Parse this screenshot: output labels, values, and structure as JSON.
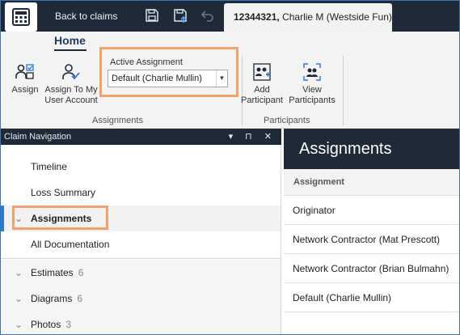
{
  "titlebar": {
    "back_label": "Back to claims",
    "icons": [
      "save-icon",
      "save-upload-icon",
      "undo-icon"
    ],
    "tab_claim_number": "12344321,",
    "tab_claim_name": " Charlie M (Westside Fun)"
  },
  "ribbon": {
    "home_tab": "Home",
    "assign_label": "Assign",
    "assign_to_me_line1": "Assign To My",
    "assign_to_me_line2": "User Account",
    "active_assignment_label": "Active Assignment",
    "active_assignment_value": "Default (Charlie Mullin)",
    "group_assignments": "Assignments",
    "add_participant_line1": "Add",
    "add_participant_line2": "Participant",
    "view_participants_line1": "View",
    "view_participants_line2": "Participants",
    "group_participants": "Participants"
  },
  "nav": {
    "title": "Claim Navigation",
    "controls": "▾ ⊓ ✕",
    "items": [
      {
        "label": "Timeline"
      },
      {
        "label": "Loss Summary"
      },
      {
        "label": "Assignments"
      },
      {
        "label": "All Documentation"
      }
    ],
    "groups": [
      {
        "label": "Estimates",
        "count": "6"
      },
      {
        "label": "Diagrams",
        "count": "6"
      },
      {
        "label": "Photos",
        "count": "3"
      }
    ]
  },
  "main": {
    "title": "Assignments",
    "column_header": "Assignment",
    "rows": [
      "Originator",
      "Network Contractor (Mat Prescott)",
      "Network Contractor (Brian Bulmahn)",
      "Default (Charlie Mullin)"
    ]
  },
  "colors": {
    "dark": "#1e2a38",
    "highlight": "#f4a06b",
    "accent": "#2d7ad6"
  }
}
